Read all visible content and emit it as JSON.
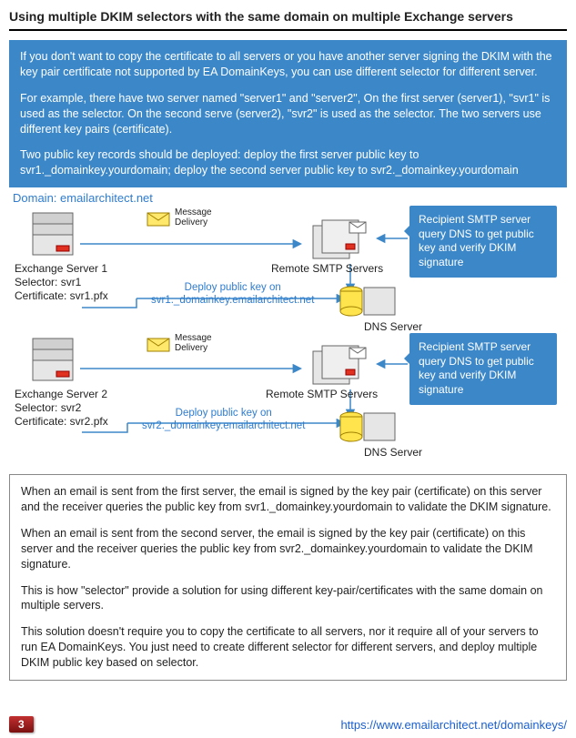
{
  "title": "Using multiple DKIM selectors with the same domain on multiple Exchange servers",
  "intro": {
    "p1": "If you don't want to copy the certificate to all servers or you have another server signing the DKIM with the key pair certificate not supported by EA DomainKeys, you can use different selector for different server.",
    "p2": "For example, there have two server named \"server1\" and \"server2\", On the first server (server1), \"svr1\" is used as the selector. On the second serve (server2), \"svr2\" is used as the selector. The two servers use different key pairs (certificate).",
    "p3": "Two public key records should be deployed: deploy the first server public key to svr1._domainkey.yourdomain; deploy the second server public key to svr2._domainkey.yourdomain"
  },
  "diagram": {
    "domain": "Domain: emailarchitect.net",
    "msg_delivery": "Message\nDelivery",
    "server1": {
      "name": "Exchange Server 1",
      "selector": "Selector: svr1",
      "cert": "Certificate: svr1.pfx"
    },
    "server2": {
      "name": "Exchange Server 2",
      "selector": "Selector: svr2",
      "cert": "Certificate: svr2.pfx"
    },
    "remote": "Remote SMTP Servers",
    "dns": "DNS Server",
    "deploy1": "Deploy public key on\nsvr1._domainkey.emailarchitect.net",
    "deploy2": "Deploy public key on\nsvr2._domainkey.emailarchitect.net",
    "callout": "Recipient SMTP server query DNS to get public key and verify DKIM signature"
  },
  "explain": {
    "p1": "When an email is sent from the first server, the email is signed by the key pair (certificate) on this server and the receiver queries the public key from svr1._domainkey.yourdomain to validate the DKIM signature.",
    "p2": "When an email is sent from the second server, the email is signed by the key pair (certificate) on this server and the receiver queries the public key from svr2._domainkey.yourdomain to validate the DKIM signature.",
    "p3": "This is how \"selector\" provide a solution for using different key-pair/certificates with the same domain on multiple servers.",
    "p4": "This solution doesn't require you to copy the certificate to all servers, nor it require all of your servers to run EA DomainKeys. You just need to create different selector for different servers, and deploy multiple DKIM public key based on selector."
  },
  "footer": {
    "page": "3",
    "url": "https://www.emailarchitect.net/domainkeys/"
  }
}
